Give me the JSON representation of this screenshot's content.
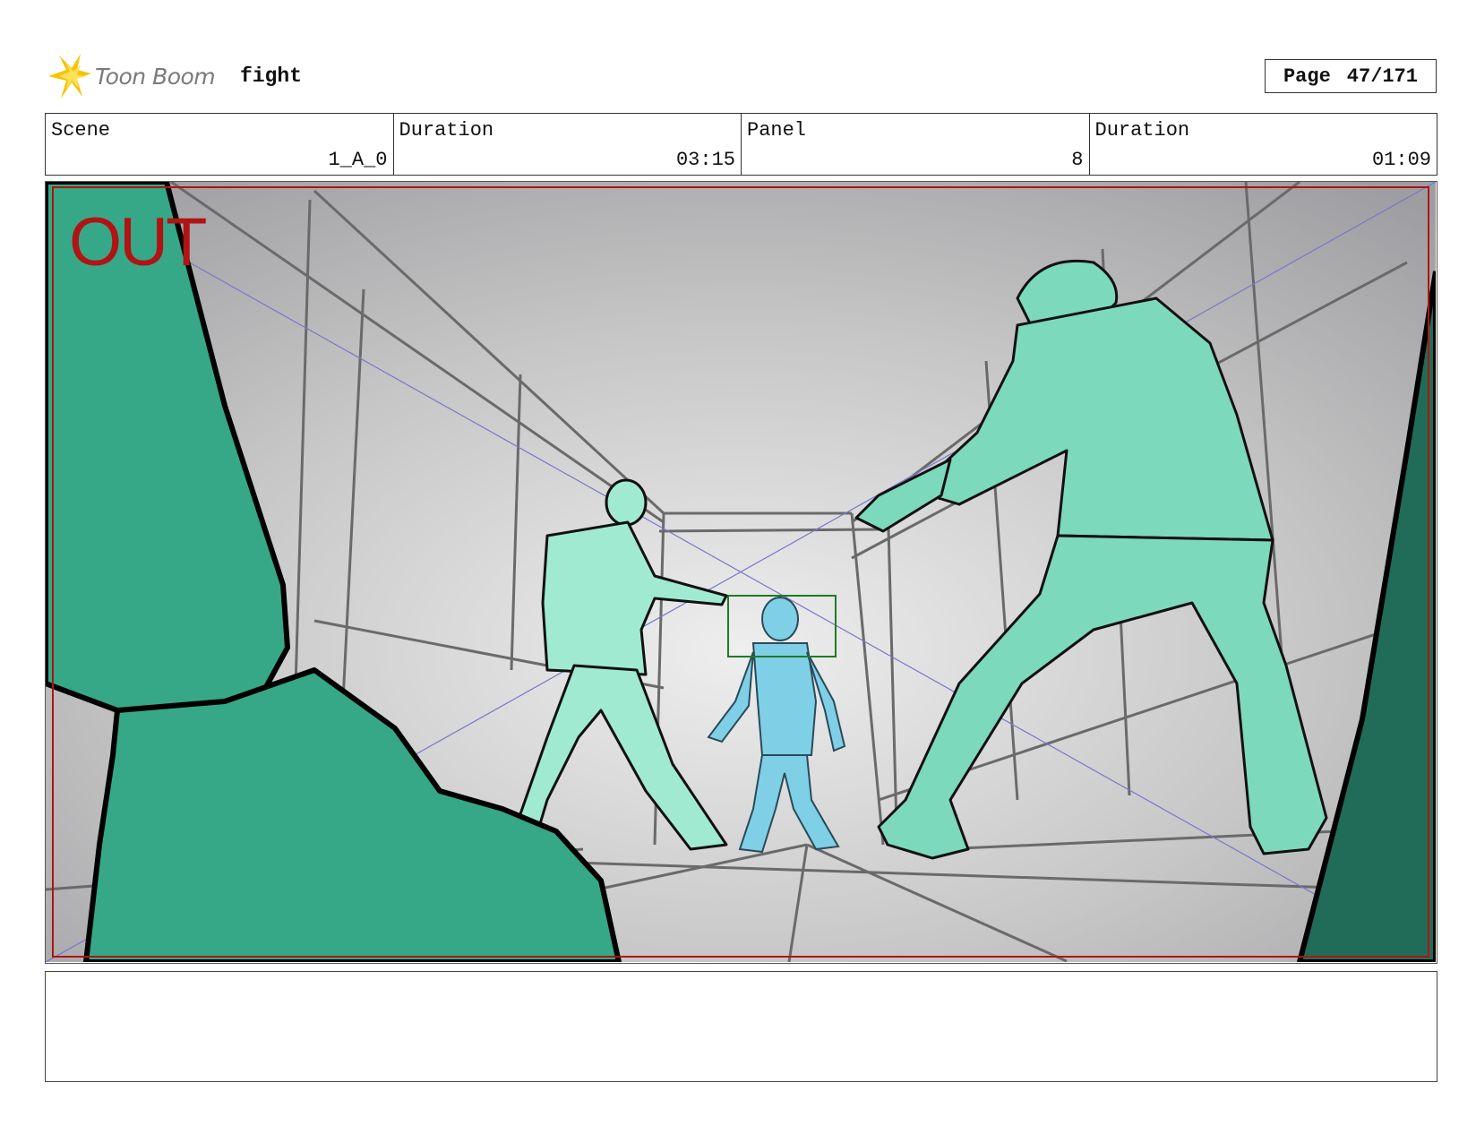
{
  "header": {
    "logo_text": "Toon Boom",
    "title": "fight",
    "page_label": "Page",
    "page_value": "47/171"
  },
  "info": {
    "scene_label": "Scene",
    "scene_value": "1_A_0",
    "duration_label": "Duration",
    "duration_value": "03:15",
    "panel_label": "Panel",
    "panel_value": "8",
    "panel_duration_label": "Duration",
    "panel_duration_value": "01:09"
  },
  "panel": {
    "out_label": "OUT"
  },
  "colors": {
    "character_green_dark": "#36a887",
    "character_green_mid": "#7dd9bc",
    "character_green_light": "#a0ead2",
    "character_blue": "#7fd0e6",
    "safe_frame_red": "#b01414",
    "focus_box_green": "#1f7a25",
    "logo_yellow": "#f6c400"
  },
  "notes": {
    "text": ""
  }
}
